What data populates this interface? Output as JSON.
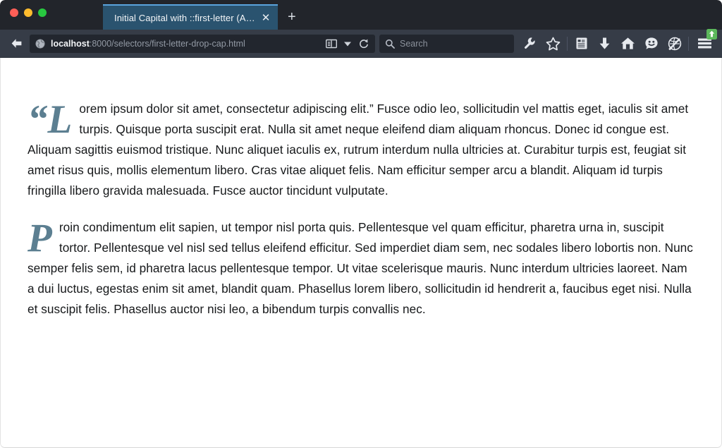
{
  "window": {
    "traffic_lights": [
      {
        "name": "close",
        "color": "#ff5f57"
      },
      {
        "name": "minimize",
        "color": "#febc2e"
      },
      {
        "name": "zoom",
        "color": "#28c840"
      }
    ]
  },
  "tabs": {
    "items": [
      {
        "title": "Initial Capital with ::first-letter (A…",
        "active": true,
        "close_label": "✕"
      }
    ],
    "new_tab_label": "+"
  },
  "navbar": {
    "back_label": "Back",
    "url": {
      "host": "localhost",
      "rest": ":8000/selectors/first-letter-drop-cap.html",
      "full": "localhost:8000/selectors/first-letter-drop-cap.html"
    },
    "url_actions": [
      {
        "name": "reader-view-icon",
        "label": "Reader View"
      },
      {
        "name": "chevron-down-icon",
        "label": "Page actions"
      },
      {
        "name": "reload-icon",
        "label": "Reload"
      }
    ],
    "search": {
      "placeholder": "Search"
    },
    "tool_icons": [
      {
        "name": "wrench-icon",
        "label": "Developer Tools"
      },
      {
        "name": "star-icon",
        "label": "Bookmark"
      },
      {
        "name": "reading-list-icon",
        "label": "Reading List"
      },
      {
        "name": "download-icon",
        "label": "Downloads"
      },
      {
        "name": "home-icon",
        "label": "Home"
      },
      {
        "name": "smiley-icon",
        "label": "Feedback"
      },
      {
        "name": "pocket-icon",
        "label": "Save to Pocket"
      }
    ],
    "menu": {
      "label": "Open menu",
      "badge_color": "#5cb85c",
      "badge_glyph": "↑"
    }
  },
  "page": {
    "paragraphs": [
      {
        "drop_cap": "“L",
        "body": "orem ipsum dolor sit amet, consectetur adipiscing elit.” Fusce odio leo, sollicitudin vel mattis eget, iaculis sit amet turpis. Quisque porta suscipit erat. Nulla sit amet neque eleifend diam aliquam rhoncus. Donec id congue est. Aliquam sagittis euismod tristique. Nunc aliquet iaculis ex, rutrum interdum nulla ultricies at. Curabitur turpis est, feugiat sit amet risus quis, mollis elementum libero. Cras vitae aliquet felis. Nam efficitur semper arcu a blandit. Aliquam id turpis fringilla libero gravida malesuada. Fusce auctor tincidunt vulputate."
      },
      {
        "drop_cap": "P",
        "body": "roin condimentum elit sapien, ut tempor nisl porta quis. Pellentesque vel quam efficitur, pharetra urna in, suscipit tortor. Pellentesque vel nisl sed tellus eleifend efficitur. Sed imperdiet diam sem, nec sodales libero lobortis non. Nunc semper felis sem, id pharetra lacus pellentesque tempor. Ut vitae scelerisque mauris. Nunc interdum ultricies laoreet. Nam a dui luctus, egestas enim sit amet, blandit quam. Phasellus lorem libero, sollicitudin id hendrerit a, faucibus eget nisi. Nulla et suscipit felis. Phasellus auctor nisi leo, a bibendum turpis convallis nec."
      }
    ],
    "drop_cap_color": "#5c7f91",
    "text_color": "#16181a",
    "background": "#ffffff"
  }
}
